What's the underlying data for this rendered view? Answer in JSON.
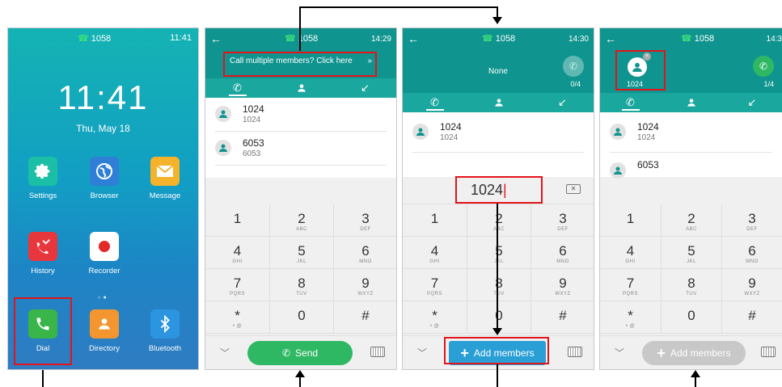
{
  "colors": {
    "header_teal": "#10948f",
    "tab_teal": "#1aa79e",
    "highlight_red": "#e2141b",
    "send_green": "#2fb864",
    "add_blue": "#2a9fd6",
    "add_disabled": "#c8c8c8"
  },
  "screen1": {
    "extension": "1058",
    "time_small": "11:41",
    "clock": "11:41",
    "date": "Thu, May 18",
    "apps": [
      {
        "label": "Settings",
        "icon": "gear-icon"
      },
      {
        "label": "Browser",
        "icon": "globe-icon"
      },
      {
        "label": "Message",
        "icon": "envelope-icon"
      },
      {
        "label": "History",
        "icon": "missed-call-icon"
      },
      {
        "label": "Recorder",
        "icon": "record-icon"
      },
      {
        "label": "Dial",
        "icon": "phone-icon"
      },
      {
        "label": "Directory",
        "icon": "contact-icon"
      },
      {
        "label": "Bluetooth",
        "icon": "bluetooth-icon"
      }
    ]
  },
  "screen2": {
    "extension": "1058",
    "time": "14:29",
    "banner": "Call multiple members? Click here",
    "banner_chevron": "»",
    "contacts": [
      {
        "name": "1024",
        "number": "1024"
      },
      {
        "name": "6053",
        "number": "6053"
      }
    ],
    "send_label": "Send"
  },
  "screen3": {
    "extension": "1058",
    "time": "14:30",
    "member_name": "None",
    "member_count": "0/4",
    "contacts": [
      {
        "name": "1024",
        "number": "1024"
      }
    ],
    "dial_input": "1024",
    "add_label": "Add members"
  },
  "screen4": {
    "extension": "1058",
    "time": "14:3",
    "member_number": "1024",
    "member_count": "1/4",
    "contacts": [
      {
        "name": "1024",
        "number": "1024"
      },
      {
        "name": "6053",
        "number": ""
      }
    ],
    "add_label": "Add members"
  },
  "keypad": [
    {
      "digit": "1",
      "letters": ""
    },
    {
      "digit": "2",
      "letters": "ABC"
    },
    {
      "digit": "3",
      "letters": "DEF"
    },
    {
      "digit": "4",
      "letters": "GHI"
    },
    {
      "digit": "5",
      "letters": "JKL"
    },
    {
      "digit": "6",
      "letters": "MNO"
    },
    {
      "digit": "7",
      "letters": "PQRS"
    },
    {
      "digit": "8",
      "letters": "TUV"
    },
    {
      "digit": "9",
      "letters": "WXYZ"
    },
    {
      "digit": "*",
      "letters": "• @"
    },
    {
      "digit": "0",
      "letters": ""
    },
    {
      "digit": "#",
      "letters": ""
    }
  ]
}
